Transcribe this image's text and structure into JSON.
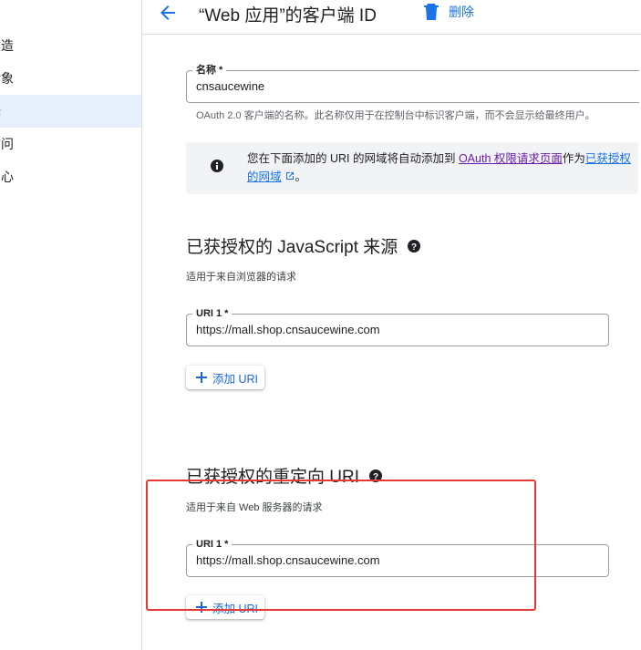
{
  "sidebar": {
    "items": [
      {
        "label": "建造"
      },
      {
        "label": "对象"
      },
      {
        "label": "端"
      },
      {
        "label": "访问"
      },
      {
        "label": "中心"
      }
    ]
  },
  "header": {
    "title": "“Web 应用”的客户端 ID",
    "delete_label": "删除"
  },
  "name_field": {
    "label": "名称 *",
    "value": "cnsaucewine",
    "hint": "OAuth 2.0 客户端的名称。此名称仅用于在控制台中标识客户端，而不会显示给最终用户。"
  },
  "info": {
    "text_before": "您在下面添加的 URI 的网域将自动添加到 ",
    "link1": "OAuth 权限请求页面",
    "text_middle": "作为",
    "link2": "已获授权的网域",
    "text_after": "。"
  },
  "js_origins": {
    "title": "已获授权的 JavaScript 来源",
    "subtitle": "适用于来自浏览器的请求",
    "uri_label": "URI 1 *",
    "uri_value": "https://mall.shop.cnsaucewine.com",
    "add_label": "添加 URI"
  },
  "redirect_uris": {
    "title": "已获授权的重定向 URI",
    "subtitle": "适用于来自 Web 服务器的请求",
    "uri_label": "URI 1 *",
    "uri_value": "https://mall.shop.cnsaucewine.com",
    "add_label": "添加 URI"
  },
  "colors": {
    "accent": "#1a73e8",
    "highlight": "#e53935"
  }
}
